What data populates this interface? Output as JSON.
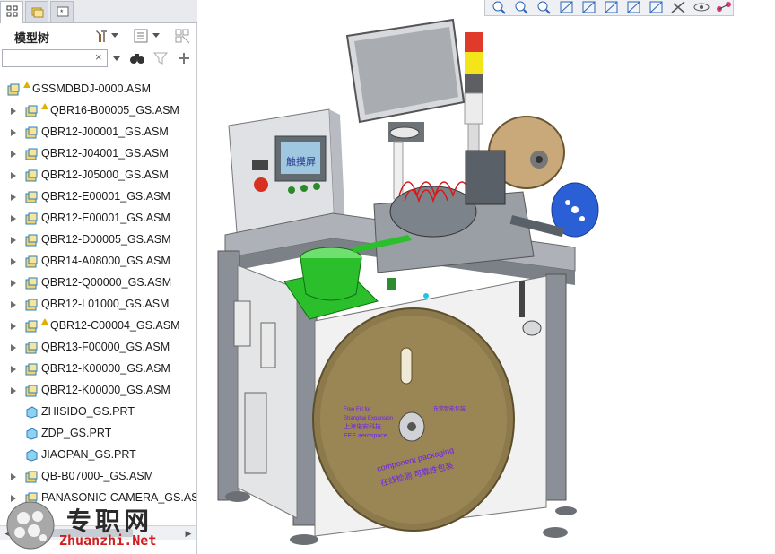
{
  "app": {
    "tabs": [
      "model-tree-tab",
      "folder-browser-tab",
      "favorites-tab"
    ]
  },
  "model_tree": {
    "title": "模型树",
    "search": {
      "value": "",
      "placeholder": "",
      "clear_glyph": "×"
    },
    "items": [
      {
        "label": "GSSMDBDJ-0000.ASM",
        "type": "asm",
        "expandable": false,
        "warning": true,
        "level": 0
      },
      {
        "label": "QBR16-B00005_GS.ASM",
        "type": "asm",
        "expandable": true,
        "warning": true,
        "level": 1
      },
      {
        "label": "QBR12-J00001_GS.ASM",
        "type": "asm",
        "expandable": true,
        "warning": false,
        "level": 1
      },
      {
        "label": "QBR12-J04001_GS.ASM",
        "type": "asm",
        "expandable": true,
        "warning": false,
        "level": 1
      },
      {
        "label": "QBR12-J05000_GS.ASM",
        "type": "asm",
        "expandable": true,
        "warning": false,
        "level": 1
      },
      {
        "label": "QBR12-E00001_GS.ASM",
        "type": "asm",
        "expandable": true,
        "warning": false,
        "level": 1
      },
      {
        "label": "QBR12-E00001_GS.ASM",
        "type": "asm",
        "expandable": true,
        "warning": false,
        "level": 1
      },
      {
        "label": "QBR12-D00005_GS.ASM",
        "type": "asm",
        "expandable": true,
        "warning": false,
        "level": 1
      },
      {
        "label": "QBR14-A08000_GS.ASM",
        "type": "asm",
        "expandable": true,
        "warning": false,
        "level": 1
      },
      {
        "label": "QBR12-Q00000_GS.ASM",
        "type": "asm",
        "expandable": true,
        "warning": false,
        "level": 1
      },
      {
        "label": "QBR12-L01000_GS.ASM",
        "type": "asm",
        "expandable": true,
        "warning": false,
        "level": 1
      },
      {
        "label": "QBR12-C00004_GS.ASM",
        "type": "asm",
        "expandable": true,
        "warning": true,
        "level": 1
      },
      {
        "label": "QBR13-F00000_GS.ASM",
        "type": "asm",
        "expandable": true,
        "warning": false,
        "level": 1
      },
      {
        "label": "QBR12-K00000_GS.ASM",
        "type": "asm",
        "expandable": true,
        "warning": false,
        "level": 1
      },
      {
        "label": "QBR12-K00000_GS.ASM",
        "type": "asm",
        "expandable": true,
        "warning": false,
        "level": 1
      },
      {
        "label": "ZHISIDO_GS.PRT",
        "type": "prt",
        "expandable": false,
        "warning": false,
        "level": 1
      },
      {
        "label": "ZDP_GS.PRT",
        "type": "prt",
        "expandable": false,
        "warning": false,
        "level": 1
      },
      {
        "label": "JIAOPAN_GS.PRT",
        "type": "prt",
        "expandable": false,
        "warning": false,
        "level": 1
      },
      {
        "label": "QB-B07000-_GS.ASM",
        "type": "asm",
        "expandable": true,
        "warning": false,
        "level": 1
      },
      {
        "label": "PANASONIC-CAMERA_GS.ASM",
        "type": "asm",
        "expandable": true,
        "warning": false,
        "level": 1
      }
    ]
  },
  "graphics_toolbar": {
    "buttons": [
      "refit-icon",
      "zoom-in-icon",
      "zoom-out-icon",
      "repaint-icon",
      "view-manager-icon",
      "saved-views-icon",
      "display-style-icon",
      "perspective-icon",
      "datum-display-icon",
      "annotation-display-icon",
      "spin-center-icon"
    ]
  },
  "model_view": {
    "touchscreen_label": "触摸屏",
    "reel_text_lines": [
      "component  packaging",
      "在线检测  可靠性包装",
      "Free  Fill  for",
      "Shanghai  Expansion",
      "EEE  aerospace",
      "上海诺安科技",
      "东莞智能包装"
    ]
  },
  "watermark": {
    "title": "专职网",
    "url": "Zhuanzhi.Net"
  },
  "colors": {
    "panel_bg": "#ffffff",
    "tree_text": "#1a1a1a",
    "asm_icon": "#f2d26a",
    "asm_icon_edge": "#2a7fbf",
    "prt_icon": "#8fd2f0",
    "warning": "#e0b000",
    "frame_gray": "#8a8f98",
    "reel_brown": "#8d7a4c",
    "green_base": "#2bbf2b",
    "reel_blue": "#2b5fd6"
  }
}
